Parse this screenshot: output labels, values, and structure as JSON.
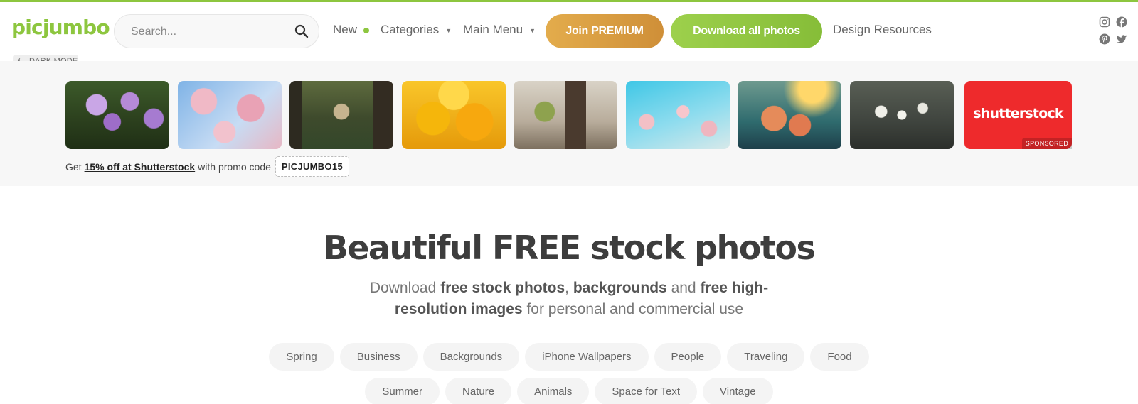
{
  "header": {
    "logo": "picjumbo",
    "search_placeholder": "Search...",
    "nav": {
      "new_label": "New",
      "categories_label": "Categories",
      "main_menu_label": "Main Menu",
      "design_resources_label": "Design Resources"
    },
    "premium_button": "Join PREMIUM",
    "download_button": "Download all photos",
    "dark_mode_label": "DARK MODE",
    "social_icons": [
      "instagram-icon",
      "facebook-icon",
      "pinterest-icon",
      "twitter-icon"
    ],
    "accent_color": "#8dc63f"
  },
  "strip": {
    "sponsor_brand": "shutterstock",
    "sponsor_badge": "SPONSORED",
    "promo_prefix": "Get",
    "promo_link": "15% off at Shutterstock",
    "promo_middle": "with promo code",
    "promo_code": "PICJUMBO15"
  },
  "hero": {
    "title": "Beautiful FREE stock photos",
    "sub_1": "Download",
    "sub_2": "free stock photos",
    "sub_3": ",",
    "sub_4": "backgrounds",
    "sub_5": "and",
    "sub_6": "free high-resolution images",
    "sub_7": "for personal and commercial use"
  },
  "tags": {
    "row1": [
      "Spring",
      "Business",
      "Backgrounds",
      "iPhone Wallpapers",
      "People",
      "Traveling",
      "Food"
    ],
    "row2": [
      "Summer",
      "Nature",
      "Animals",
      "Space for Text",
      "Vintage"
    ]
  }
}
